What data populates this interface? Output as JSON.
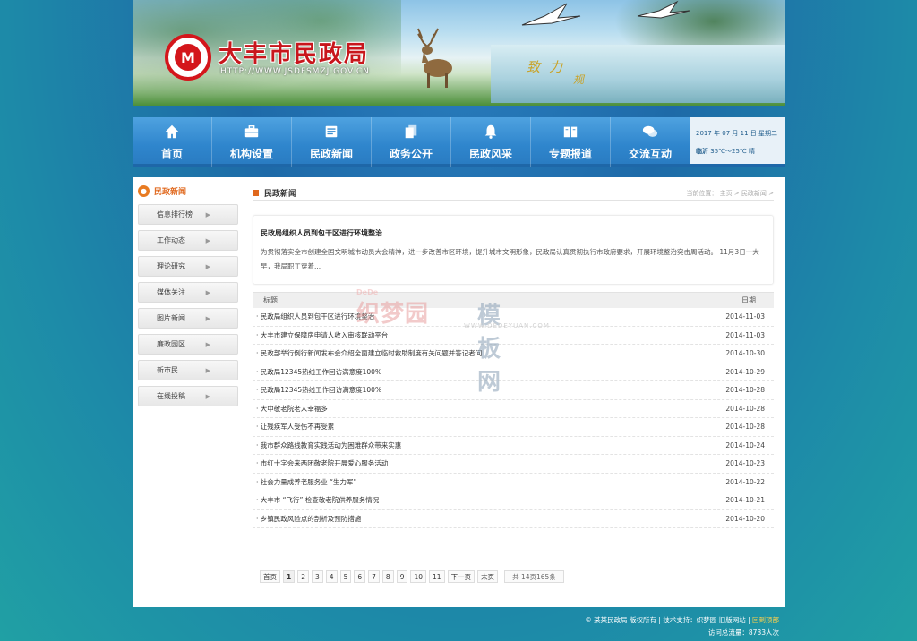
{
  "banner": {
    "site_title": "大丰市民政局",
    "site_url": "HTTP://WWW.JSDFSMZJ.GOV.CN",
    "slogan": "致力",
    "slogan2": "规"
  },
  "nav": {
    "items": [
      {
        "label": "首页",
        "icon": "home-icon"
      },
      {
        "label": "机构设置",
        "icon": "briefcase-icon"
      },
      {
        "label": "民政新闻",
        "icon": "newspaper-icon"
      },
      {
        "label": "政务公开",
        "icon": "documents-icon"
      },
      {
        "label": "民政风采",
        "icon": "bell-icon"
      },
      {
        "label": "专题报道",
        "icon": "book-icon"
      },
      {
        "label": "交流互动",
        "icon": "chat-icon"
      }
    ],
    "date_text": "2017 年 07 月 11 日 星期二",
    "weather_city": "临沂",
    "weather_temp": "35℃～25℃ 晴"
  },
  "sidebar": {
    "title": "民政新闻",
    "items": [
      "信息排行榜",
      "工作动态",
      "理论研究",
      "媒体关注",
      "图片新闻",
      "廉政园区",
      "新市民",
      "在线投稿"
    ]
  },
  "content": {
    "section_title": "民政新闻",
    "location": "当前位置： 主页 > 民政新闻 >",
    "feature_title": "民政局组织人员到包干区进行环境整治",
    "feature_summary": "为贯彻落实全市创建全国文明城市动员大会精神，进一步改善市区环境，提升城市文明形象，民政局认真贯彻执行市政府要求，开展环境整治突击周活动。 11月3日一大早，我局职工穿着...",
    "col_title": "标题",
    "col_date": "日期",
    "rows": [
      {
        "title": "· 民政局组织人员到包干区进行环境整治",
        "date": "2014-11-03"
      },
      {
        "title": "· 大丰市建立保障房申请人收入审核联动平台",
        "date": "2014-11-03"
      },
      {
        "title": "· 民政部举行例行新闻发布会介绍全面建立临时救助制度有关问题并答记者问",
        "date": "2014-10-30"
      },
      {
        "title": "· 民政局12345热线工作回访满意度100%",
        "date": "2014-10-29"
      },
      {
        "title": "· 民政局12345热线工作回访满意度100%",
        "date": "2014-10-28"
      },
      {
        "title": "· 大中敬老院老人幸福多",
        "date": "2014-10-28"
      },
      {
        "title": "· 让残疾军人受伤不再受累",
        "date": "2014-10-28"
      },
      {
        "title": "· 我市群众路线教育实践活动为困难群众带来实惠",
        "date": "2014-10-24"
      },
      {
        "title": "· 市红十字会来西团敬老院开展爱心服务活动",
        "date": "2014-10-23"
      },
      {
        "title": "· 社会力量成养老服务业 “生力军”",
        "date": "2014-10-22"
      },
      {
        "title": "· 大丰市 “飞行” 检查敬老院供养服务情况",
        "date": "2014-10-21"
      },
      {
        "title": "· 乡镇民政风险点的剖析及预防措施",
        "date": "2014-10-20"
      }
    ],
    "pager": {
      "first": "首页",
      "pages": [
        "1",
        "2",
        "3",
        "4",
        "5",
        "6",
        "7",
        "8",
        "9",
        "10",
        "11"
      ],
      "current": "1",
      "next": "下一页",
      "last": "末页",
      "info": "共 14页165条"
    }
  },
  "watermark": {
    "brand": "DeDe",
    "text1": "织梦园",
    "text2": "模板网",
    "url": "WWW.DEDEYUAN.COM"
  },
  "footer": {
    "copyright": "© 某某民政局 版权所有",
    "support": "技术支持：织梦园",
    "old_site": "旧版网站",
    "back_top": "回到顶部",
    "visits": "访问总流量：8733人次"
  }
}
